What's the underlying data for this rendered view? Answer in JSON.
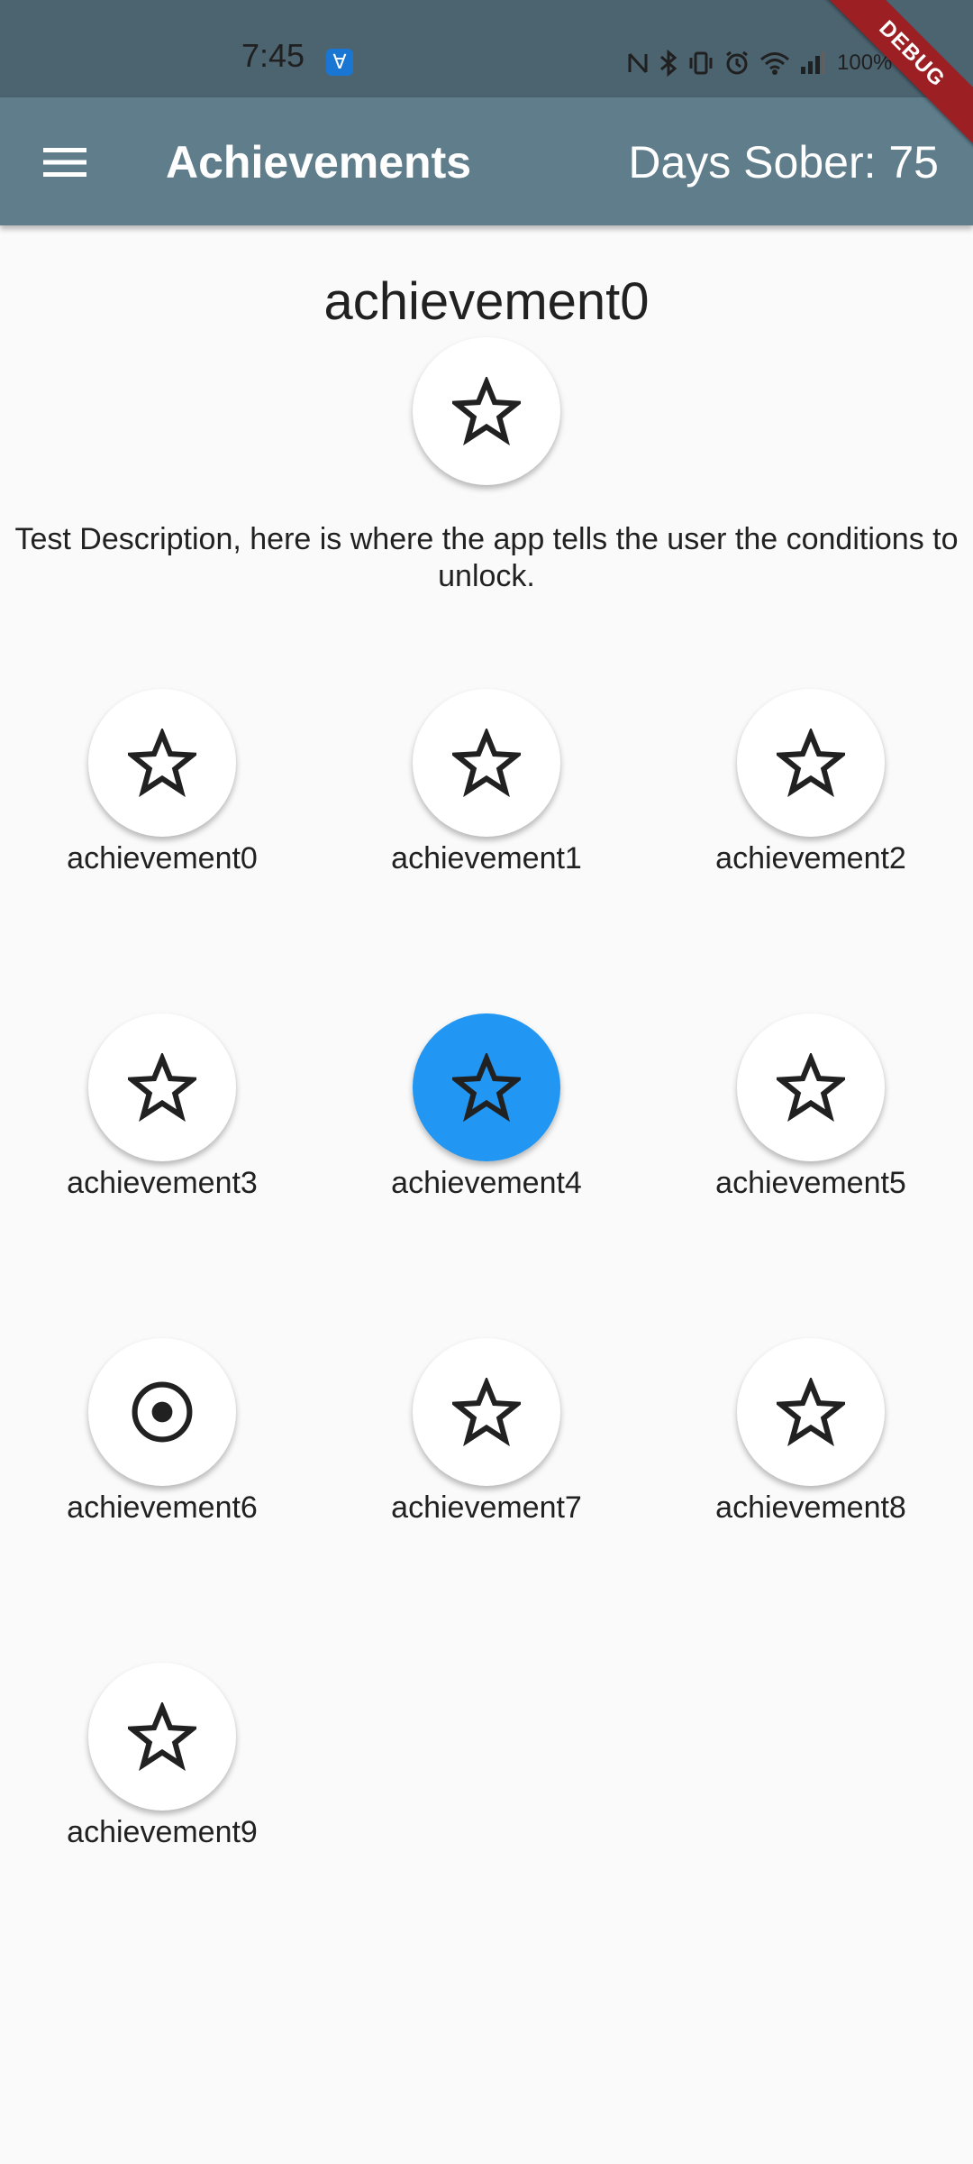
{
  "status_bar": {
    "time": "7:45",
    "battery": "100%"
  },
  "debug_banner": "DEBUG",
  "app_bar": {
    "title": "Achievements",
    "days_sober": "Days Sober: 75"
  },
  "selected": {
    "title": "achievement0",
    "description": "Test Description, here is where the app tells the user the conditions to unlock.",
    "icon": "star-outline-icon"
  },
  "achievements": [
    {
      "label": "achievement0",
      "icon": "star-outline-icon",
      "selected": false
    },
    {
      "label": "achievement1",
      "icon": "star-outline-icon",
      "selected": false
    },
    {
      "label": "achievement2",
      "icon": "star-outline-icon",
      "selected": false
    },
    {
      "label": "achievement3",
      "icon": "star-outline-icon",
      "selected": false
    },
    {
      "label": "achievement4",
      "icon": "star-outline-icon",
      "selected": true
    },
    {
      "label": "achievement5",
      "icon": "star-outline-icon",
      "selected": false
    },
    {
      "label": "achievement6",
      "icon": "radio-button-checked-icon",
      "selected": false
    },
    {
      "label": "achievement7",
      "icon": "star-outline-icon",
      "selected": false
    },
    {
      "label": "achievement8",
      "icon": "star-outline-icon",
      "selected": false
    },
    {
      "label": "achievement9",
      "icon": "star-outline-icon",
      "selected": false
    }
  ],
  "colors": {
    "status_bar": "#4c6370",
    "app_bar": "#607d8b",
    "selected_badge": "#2196f3",
    "badge": "#ffffff",
    "background": "#fafafa",
    "debug_ribbon": "#9b1f23"
  }
}
